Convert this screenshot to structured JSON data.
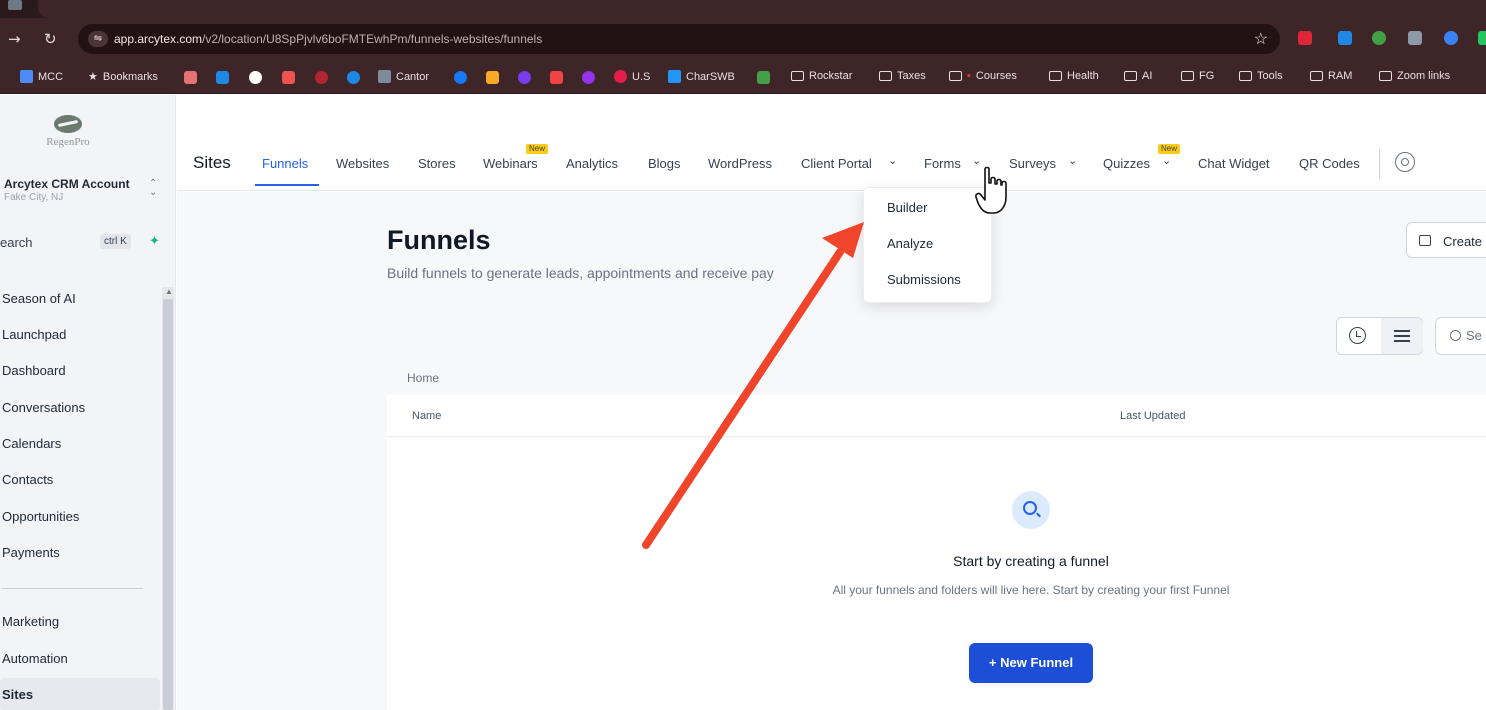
{
  "browser": {
    "url_prefix": "app.arcytex.com",
    "url_rest": "/v2/location/U8SpPjvlv6boFMTEwhPm/funnels-websites/funnels",
    "bookmarks": [
      {
        "label": "MCC",
        "color": "#4c8bf5",
        "kind": "icon"
      },
      {
        "label": "Bookmarks",
        "color": "#eadfe0",
        "kind": "star"
      },
      {
        "label": "Cantor",
        "color": "#7d8b9c",
        "kind": "icon"
      },
      {
        "label": "U.S",
        "color": "#e11d48",
        "kind": "icon"
      },
      {
        "label": "CharSWB",
        "color": "#2196f3",
        "kind": "icon"
      },
      {
        "label": "Rockstar",
        "kind": "folder"
      },
      {
        "label": "Taxes",
        "kind": "folder"
      },
      {
        "label": "Courses",
        "kind": "folder"
      },
      {
        "label": "Health",
        "kind": "folder"
      },
      {
        "label": "AI",
        "kind": "folder"
      },
      {
        "label": "FG",
        "kind": "folder"
      },
      {
        "label": "Tools",
        "kind": "folder"
      },
      {
        "label": "RAM",
        "kind": "folder"
      },
      {
        "label": "Zoom links",
        "kind": "folder"
      }
    ]
  },
  "sidebar": {
    "logo_text": "RegenPro",
    "account_name": "Arcytex CRM Account",
    "account_location": "Fake City, NJ",
    "search_label": "earch",
    "search_shortcut": "ctrl K",
    "items": [
      "Season of AI",
      "Launchpad",
      "Dashboard",
      "Conversations",
      "Calendars",
      "Contacts",
      "Opportunities",
      "Payments"
    ],
    "items_lower": [
      "Marketing",
      "Automation",
      "Sites"
    ],
    "active_item": "Sites"
  },
  "topnav": {
    "title": "Sites",
    "links": {
      "funnels": "Funnels",
      "websites": "Websites",
      "stores": "Stores",
      "webinars": "Webinars",
      "analytics": "Analytics",
      "blogs": "Blogs",
      "wordpress": "WordPress",
      "client_portal": "Client Portal",
      "forms": "Forms",
      "surveys": "Surveys",
      "quizzes": "Quizzes",
      "chat_widget": "Chat Widget",
      "qr_codes": "QR Codes"
    },
    "new_badge": "New"
  },
  "forms_dropdown": {
    "items": [
      "Builder",
      "Analyze",
      "Submissions"
    ]
  },
  "main": {
    "title": "Funnels",
    "subtitle": "Build funnels to generate leads, appointments and receive pay",
    "create_label": "Create",
    "search_placeholder": "Se",
    "breadcrumb": "Home",
    "col_name": "Name",
    "col_updated": "Last Updated",
    "empty_title": "Start by creating a funnel",
    "empty_desc": "All your funnels and folders will live here. Start by creating your first Funnel",
    "new_funnel": "+ New Funnel"
  },
  "colors": {
    "accent": "#2563eb",
    "annotation_arrow": "#f0452a",
    "badge": "#facc15"
  }
}
